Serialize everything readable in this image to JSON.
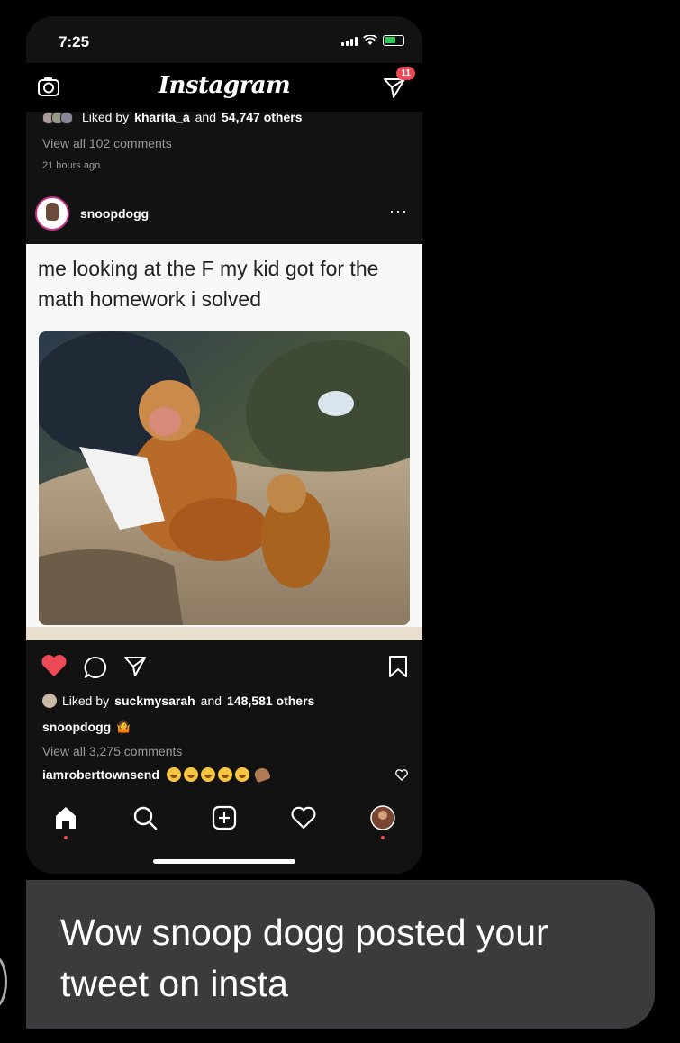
{
  "status": {
    "time": "7:25"
  },
  "header": {
    "logo": "Instagram",
    "dm_badge": "11"
  },
  "previous_post": {
    "liked_by_prefix": "Liked by",
    "liked_by_user": "kharita_a",
    "liked_by_and": "and",
    "liked_by_count": "54,747 others",
    "view_comments": "View all 102 comments",
    "time_ago": "21 hours ago"
  },
  "post": {
    "username": "snoopdogg",
    "more": "···",
    "caption_in_image": "me looking at the F my kid got for the math homework i solved",
    "liked_by_prefix": "Liked by",
    "liked_by_user": "suckmysarah",
    "liked_by_and": "and",
    "liked_by_count": "148,581 others",
    "caption_username": "snoopdogg",
    "view_comments": "View all 3,275 comments",
    "comment_user": "iamroberttownsend"
  },
  "message": {
    "text": "Wow snoop dogg posted your tweet on insta"
  },
  "colors": {
    "like_red": "#ed4956",
    "bubble_gray": "#3b3b3d",
    "phone_bg": "#121212"
  },
  "icons": [
    "camera-icon",
    "direct-message-icon",
    "heart-icon",
    "comment-icon",
    "share-icon",
    "bookmark-icon",
    "home-icon",
    "search-icon",
    "add-post-icon",
    "activity-heart-icon",
    "profile-icon"
  ]
}
